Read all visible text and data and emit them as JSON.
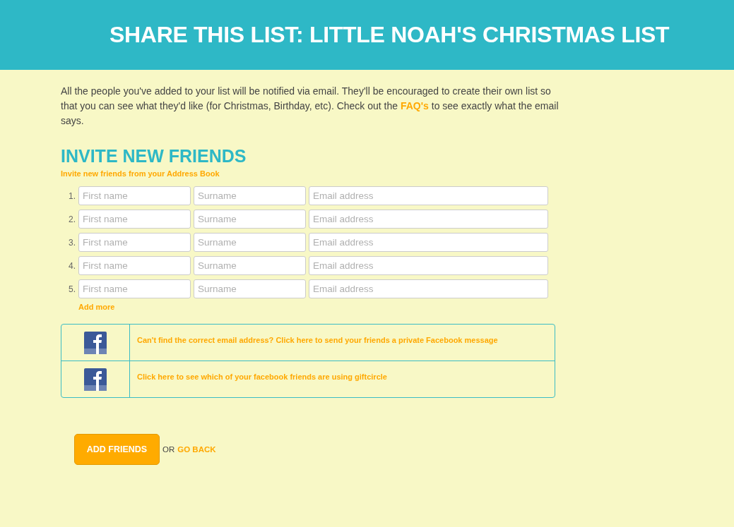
{
  "header": {
    "title": "SHARE THIS LIST: LITTLE NOAH'S CHRISTMAS LIST"
  },
  "intro": {
    "text_before": "All the people you've added to your list will be notified via email. They'll be encouraged to create their own list so that you can see what they'd like (for Christmas, Birthday, etc). Check out the",
    "link": "FAQ's",
    "text_after": "to see exactly what the email says."
  },
  "invite": {
    "heading": "INVITE NEW FRIENDS",
    "address_book_link": "Invite new friends from your Address Book",
    "rows": [
      {
        "number": "1.",
        "fields": [
          {
            "placeholder": "First name"
          },
          {
            "placeholder": "Surname"
          },
          {
            "placeholder": "Email address"
          }
        ]
      },
      {
        "number": "2.",
        "fields": [
          {
            "placeholder": "First name"
          },
          {
            "placeholder": "Surname"
          },
          {
            "placeholder": "Email address"
          }
        ]
      },
      {
        "number": "3.",
        "fields": [
          {
            "placeholder": "First name"
          },
          {
            "placeholder": "Surname"
          },
          {
            "placeholder": "Email address"
          }
        ]
      },
      {
        "number": "4.",
        "fields": [
          {
            "placeholder": "First name"
          },
          {
            "placeholder": "Surname"
          },
          {
            "placeholder": "Email address"
          }
        ]
      },
      {
        "number": "5.",
        "fields": [
          {
            "placeholder": "First name"
          },
          {
            "placeholder": "Surname"
          },
          {
            "placeholder": "Email address"
          }
        ]
      }
    ],
    "add_more": "Add more"
  },
  "facebook_options": [
    {
      "text": "Can't find the correct email address? Click here to send your friends a private Facebook message"
    },
    {
      "text": "Click here to see which of your facebook friends are using giftcircle"
    }
  ],
  "actions": {
    "primary_button": "ADD FRIENDS",
    "separator": "OR",
    "secondary_link": "GO BACK"
  }
}
